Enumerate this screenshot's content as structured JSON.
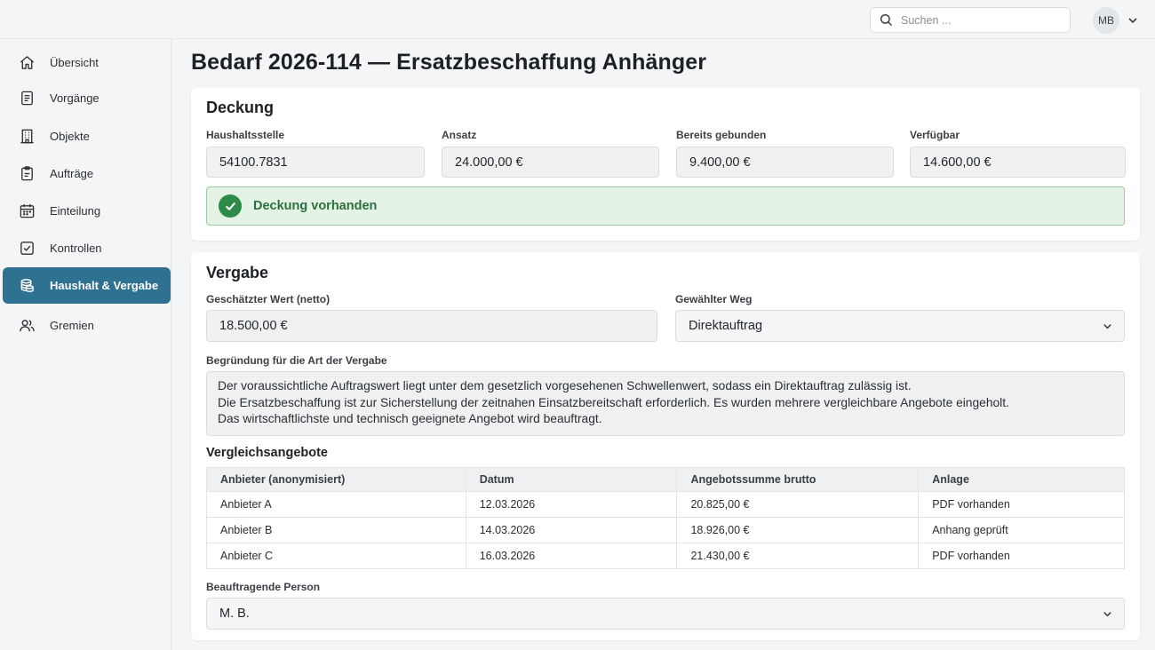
{
  "header": {
    "search_placeholder": "Suchen ...",
    "user_initials": "MB"
  },
  "sidebar": {
    "items": [
      {
        "label": "Übersicht",
        "icon": "home-icon"
      },
      {
        "label": "Vorgänge",
        "icon": "document-icon"
      },
      {
        "label": "Objekte",
        "icon": "building-icon"
      },
      {
        "label": "Aufträge",
        "icon": "clipboard-icon"
      },
      {
        "label": "Einteilung",
        "icon": "calendar-icon"
      },
      {
        "label": "Kontrollen",
        "icon": "checkbox-icon"
      },
      {
        "label": "Haushalt & Vergabe",
        "icon": "coins-icon",
        "active": true
      },
      {
        "label": "Gremien",
        "icon": "users-icon"
      }
    ],
    "active_color": "#2f7190"
  },
  "page": {
    "title": "Bedarf 2026-114 — Ersatzbeschaffung Anhänger"
  },
  "deckung": {
    "title": "Deckung",
    "fields": [
      {
        "label": "Haushaltsstelle",
        "value": "54100.7831"
      },
      {
        "label": "Ansatz",
        "value": "24.000,00 €"
      },
      {
        "label": "Bereits gebunden",
        "value": "9.400,00 €"
      },
      {
        "label": "Verfügbar",
        "value": "14.600,00 €"
      }
    ],
    "status": "Deckung vorhanden",
    "status_color": "#2e8b47"
  },
  "vergabe": {
    "title": "Vergabe",
    "estimated_label": "Geschätzter Wert (netto)",
    "estimated_value": "18.500,00 €",
    "path_label": "Gewählter Weg",
    "path_value": "Direktauftrag",
    "reason_label": "Begründung für die Art der Vergabe",
    "reason_lines": [
      "Der voraussichtliche Auftragswert liegt unter dem gesetzlich vorgesehenen Schwellenwert, sodass ein Direktauftrag zulässig ist.",
      "Die Ersatzbeschaffung ist zur Sicherstellung der zeitnahen Einsatzbereitschaft erforderlich. Es wurden mehrere vergleichbare Angebote eingeholt.",
      "Das wirtschaftlichste und technisch geeignete Angebot wird beauftragt."
    ],
    "offers_title": "Vergleichsangebote",
    "offers_columns": [
      "Anbieter (anonymisiert)",
      "Datum",
      "Angebotssumme brutto",
      "Anlage"
    ],
    "offers_rows": [
      [
        "Anbieter A",
        "12.03.2026",
        "20.825,00 €",
        "PDF vorhanden"
      ],
      [
        "Anbieter B",
        "14.03.2026",
        "18.926,00 €",
        "Anhang geprüft"
      ],
      [
        "Anbieter C",
        "16.03.2026",
        "21.430,00 €",
        "PDF vorhanden"
      ]
    ],
    "person_label": "Beauftragende Person",
    "person_value": "M. B."
  }
}
